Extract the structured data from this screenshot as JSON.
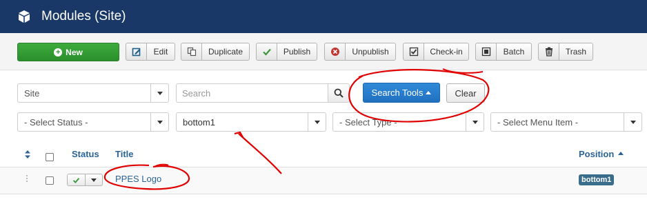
{
  "header": {
    "title": "Modules (Site)",
    "icon": "cube-icon"
  },
  "toolbar": {
    "new_label": "New",
    "edit_label": "Edit",
    "duplicate_label": "Duplicate",
    "publish_label": "Publish",
    "unpublish_label": "Unpublish",
    "checkin_label": "Check-in",
    "batch_label": "Batch",
    "trash_label": "Trash"
  },
  "filters": {
    "client_value": "Site",
    "search_placeholder": "Search",
    "search_tools_label": "Search Tools",
    "clear_label": "Clear",
    "status_value": "- Select Status -",
    "position_value": "bottom1",
    "type_value": "- Select Type -",
    "menu_item_value": "- Select Menu Item -"
  },
  "table": {
    "columns": {
      "status": "Status",
      "title": "Title",
      "position": "Position"
    },
    "rows": [
      {
        "title": "PPES Logo",
        "position": "bottom1",
        "published": true
      }
    ]
  },
  "colors": {
    "header_bg": "#1a3867",
    "new_button": "#2e962e",
    "search_tools": "#2a7bd0",
    "link": "#2a6496",
    "annotation": "#e00000"
  }
}
